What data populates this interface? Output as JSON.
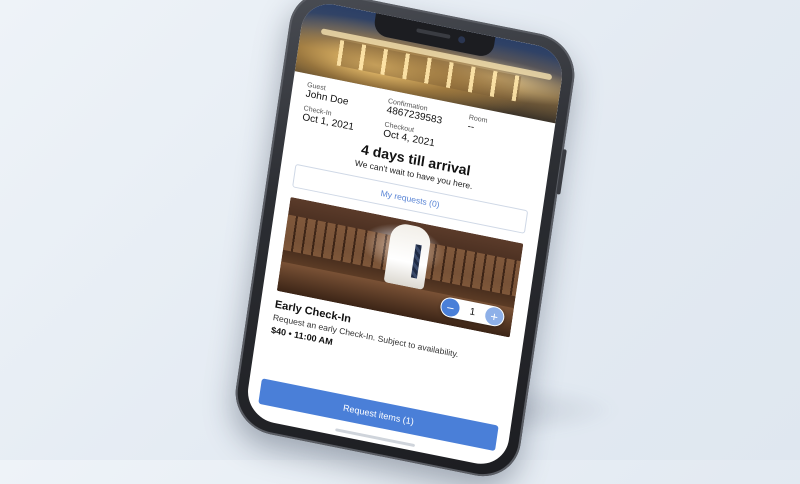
{
  "guest": {
    "label": "Guest",
    "value": "John Doe"
  },
  "confirmation": {
    "label": "Confirmation",
    "value": "4867239583"
  },
  "room": {
    "label": "Room",
    "value": "--"
  },
  "checkin": {
    "label": "Check-In",
    "value": "Oct 1, 2021"
  },
  "checkout": {
    "label": "Checkout",
    "value": "Oct 4, 2021"
  },
  "countdown": {
    "title": "4 days till arrival",
    "subtitle": "We can't wait to have you here."
  },
  "requests_button": "My requests (0)",
  "service": {
    "quantity": "1",
    "minus_symbol": "−",
    "plus_symbol": "+",
    "title": "Early Check-In",
    "description": "Request an early Check-In. Subject to availability.",
    "price_time": "$40 • 11:00 AM"
  },
  "cta_button": "Request items (1)",
  "colors": {
    "accent": "#4a7fd8",
    "link": "#5b86d6"
  }
}
